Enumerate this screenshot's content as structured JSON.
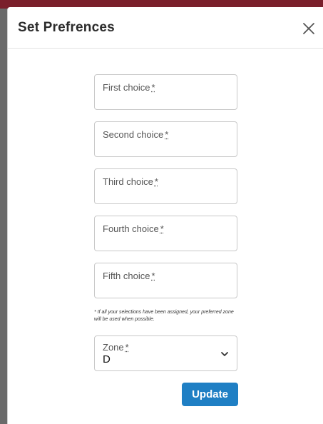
{
  "dialog": {
    "title": "Set Prefrences"
  },
  "form": {
    "required_marker": "*",
    "fields": [
      {
        "label": "First choice"
      },
      {
        "label": "Second choice"
      },
      {
        "label": "Third choice"
      },
      {
        "label": "Fourth choice"
      },
      {
        "label": "Fifth choice"
      }
    ],
    "note": "* If all your selections have been assigned, your preferred zone will be used when possible.",
    "zone": {
      "label": "Zone",
      "value": "D"
    },
    "update_label": "Update"
  },
  "colors": {
    "accent": "#1f7fc4",
    "backdrop_bar": "#7a1f2b"
  },
  "icons": {
    "close": "close-icon",
    "dropdown": "chevron-down-icon"
  }
}
